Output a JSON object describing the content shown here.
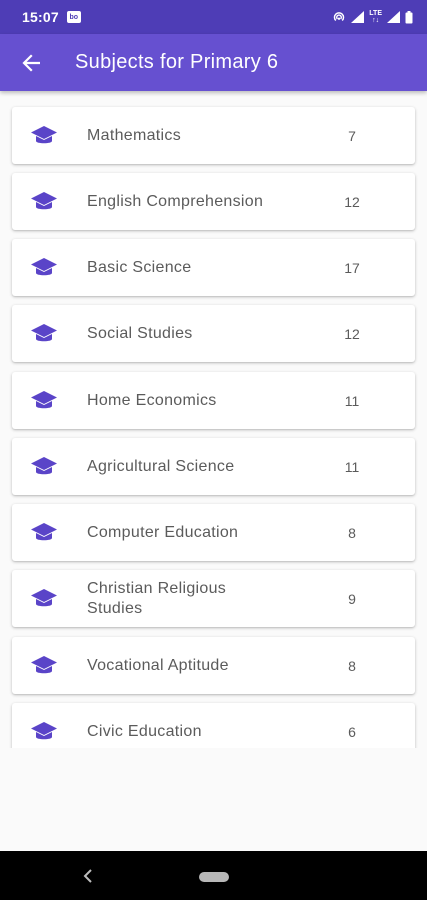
{
  "status_bar": {
    "time": "15:07",
    "app_badge": "bo",
    "network": "LTE",
    "icons": [
      "hotspot-icon",
      "signal-icon",
      "lte-icon",
      "signal-icon",
      "battery-icon"
    ]
  },
  "app_bar": {
    "title": "Subjects for Primary 6",
    "back_icon": "arrow-back-icon"
  },
  "colors": {
    "primary": "#6650d0",
    "primary_dark": "#4e3db6",
    "icon": "#5a44c8",
    "text": "#5b5b5b",
    "background": "#fafafa"
  },
  "subjects": [
    {
      "name": "Mathematics",
      "count": "7",
      "icon": "graduation-cap-icon"
    },
    {
      "name": "English Comprehension",
      "count": "12",
      "icon": "graduation-cap-icon"
    },
    {
      "name": "Basic Science",
      "count": "17",
      "icon": "graduation-cap-icon"
    },
    {
      "name": "Social Studies",
      "count": "12",
      "icon": "graduation-cap-icon"
    },
    {
      "name": "Home Economics",
      "count": "11",
      "icon": "graduation-cap-icon"
    },
    {
      "name": "Agricultural Science",
      "count": "11",
      "icon": "graduation-cap-icon"
    },
    {
      "name": "Computer Education",
      "count": "8",
      "icon": "graduation-cap-icon"
    },
    {
      "name": "Christian Religious Studies",
      "count": "9",
      "icon": "graduation-cap-icon"
    },
    {
      "name": "Vocational Aptitude",
      "count": "8",
      "icon": "graduation-cap-icon"
    },
    {
      "name": "Civic Education",
      "count": "6",
      "icon": "graduation-cap-icon"
    }
  ],
  "nav_bar": {
    "icons": [
      "nav-back-icon",
      "home-pill-icon"
    ]
  }
}
